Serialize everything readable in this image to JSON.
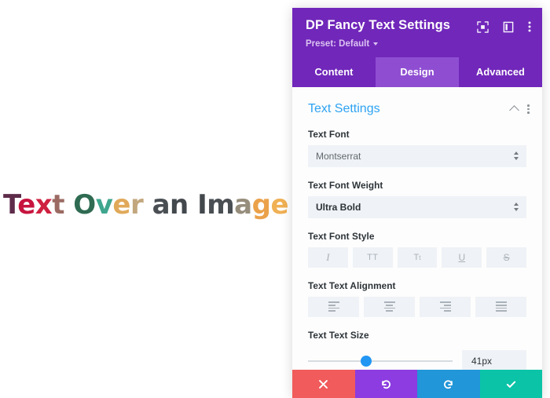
{
  "canvas": {
    "hero_text": "Text Over an Image",
    "hero_segments": [
      {
        "text": "T",
        "color": "#5e2b4a"
      },
      {
        "text": "e",
        "color": "#c7143f"
      },
      {
        "text": "x",
        "color": "#cf2040"
      },
      {
        "text": "t",
        "color": "#9b6b63"
      },
      {
        "text": " ",
        "color": "#888888"
      },
      {
        "text": "O",
        "color": "#2f6b52"
      },
      {
        "text": "v",
        "color": "#3fa68e"
      },
      {
        "text": "e",
        "color": "#e0a95a"
      },
      {
        "text": "r",
        "color": "#c2a77e"
      },
      {
        "text": " ",
        "color": "#888888"
      },
      {
        "text": "a",
        "color": "#4a4f54"
      },
      {
        "text": "n",
        "color": "#43484d"
      },
      {
        "text": " ",
        "color": "#888888"
      },
      {
        "text": "I",
        "color": "#43484d"
      },
      {
        "text": "m",
        "color": "#4a4f54"
      },
      {
        "text": "a",
        "color": "#968d7c"
      },
      {
        "text": "g",
        "color": "#eba14a"
      },
      {
        "text": "e",
        "color": "#f0b054"
      }
    ]
  },
  "panel": {
    "header": {
      "title": "DP Fancy Text Settings",
      "preset_label": "Preset: Default",
      "icons": [
        "target-focus-icon",
        "panel-layout-icon",
        "more-options-icon"
      ],
      "background_color": "#7127ba"
    },
    "tabs": [
      {
        "label": "Content",
        "active": false
      },
      {
        "label": "Design",
        "active": true
      },
      {
        "label": "Advanced",
        "active": false
      }
    ],
    "section": {
      "title": "Text Settings",
      "title_color": "#2ea3f2",
      "collapse_icon": "chevron-up-icon",
      "menu_icon": "more-options-icon"
    },
    "fields": {
      "text_font": {
        "label": "Text Font",
        "value": "Montserrat"
      },
      "text_font_weight": {
        "label": "Text Font Weight",
        "value": "Ultra Bold"
      },
      "text_font_style": {
        "label": "Text Font Style",
        "options": [
          {
            "name": "italic-style-button",
            "glyph": "I"
          },
          {
            "name": "uppercase-style-button",
            "glyph": "TT"
          },
          {
            "name": "small-caps-style-button",
            "glyph": "Tt"
          },
          {
            "name": "underline-style-button",
            "glyph": "U"
          },
          {
            "name": "strikethrough-style-button",
            "glyph": "S"
          }
        ]
      },
      "text_alignment": {
        "label": "Text Text Alignment",
        "options": [
          {
            "name": "align-left-button",
            "align": "left"
          },
          {
            "name": "align-center-button",
            "align": "center"
          },
          {
            "name": "align-right-button",
            "align": "right"
          },
          {
            "name": "align-justify-button",
            "align": "justify"
          }
        ]
      },
      "text_size": {
        "label": "Text Text Size",
        "value": "41px",
        "slider_percent": 40,
        "handle_color": "#2196f3"
      }
    },
    "actions": [
      {
        "name": "cancel-button",
        "glyph": "✕",
        "color": "#f15b5b"
      },
      {
        "name": "undo-button",
        "glyph": "↺",
        "color": "#8c3ce0"
      },
      {
        "name": "redo-button",
        "glyph": "↻",
        "color": "#2196d8"
      },
      {
        "name": "save-button",
        "glyph": "✓",
        "color": "#0bc3a7"
      }
    ]
  }
}
